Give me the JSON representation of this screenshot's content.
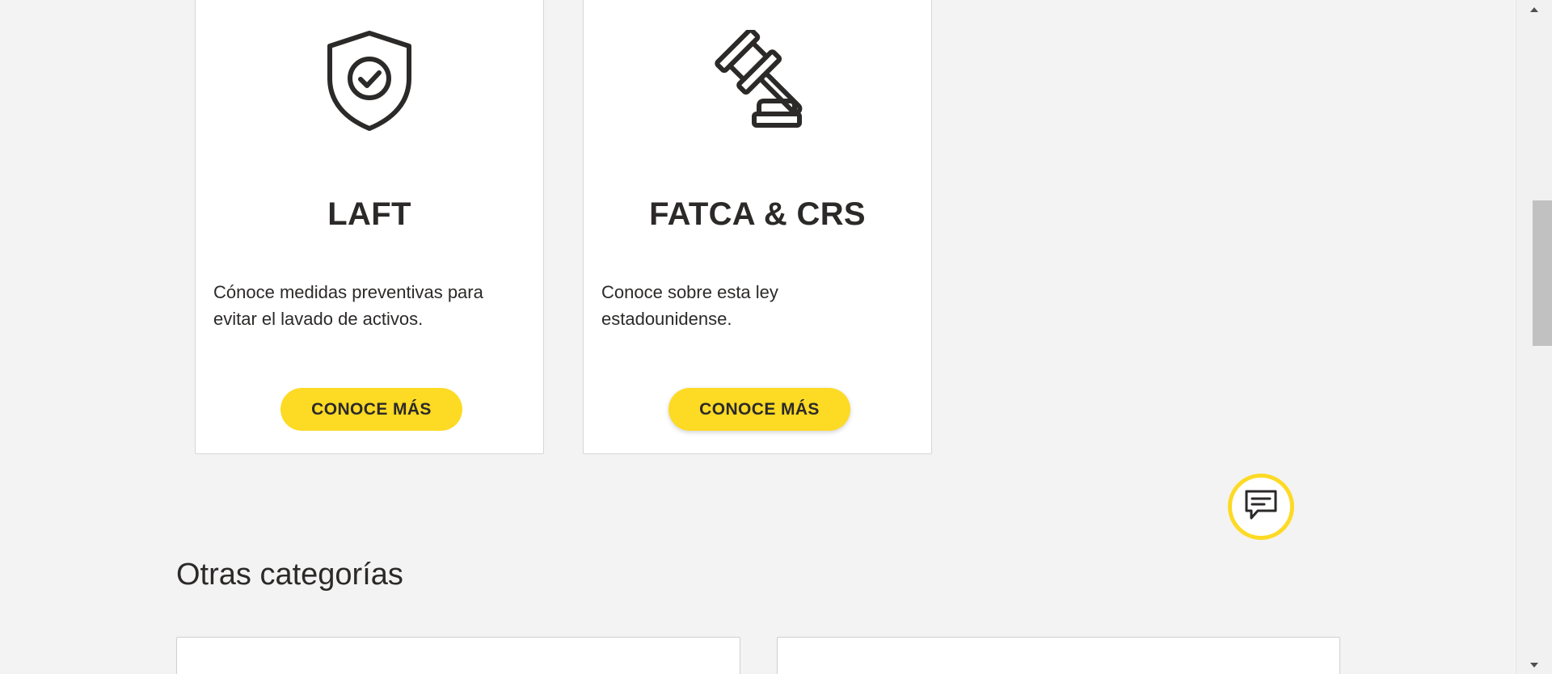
{
  "cards": [
    {
      "icon": "shield-check-icon",
      "title": "LAFT",
      "description": "Cónoce medidas preventivas para evitar el lavado de activos.",
      "button_label": "CONOCE MÁS"
    },
    {
      "icon": "gavel-icon",
      "title": "FATCA & CRS",
      "description": "Conoce sobre esta ley estadounidense.",
      "button_label": "CONOCE MÁS"
    }
  ],
  "chat": {
    "icon": "chat-bubble-icon"
  },
  "other_categories": {
    "title": "Otras categorías"
  },
  "scrollbar": {
    "up_icon": "scroll-up-arrow-icon",
    "down_icon": "scroll-down-arrow-icon"
  },
  "colors": {
    "accent": "#fdda24",
    "background": "#f3f3f3",
    "text": "#2c2a29",
    "card_border": "#d6d6d6"
  }
}
